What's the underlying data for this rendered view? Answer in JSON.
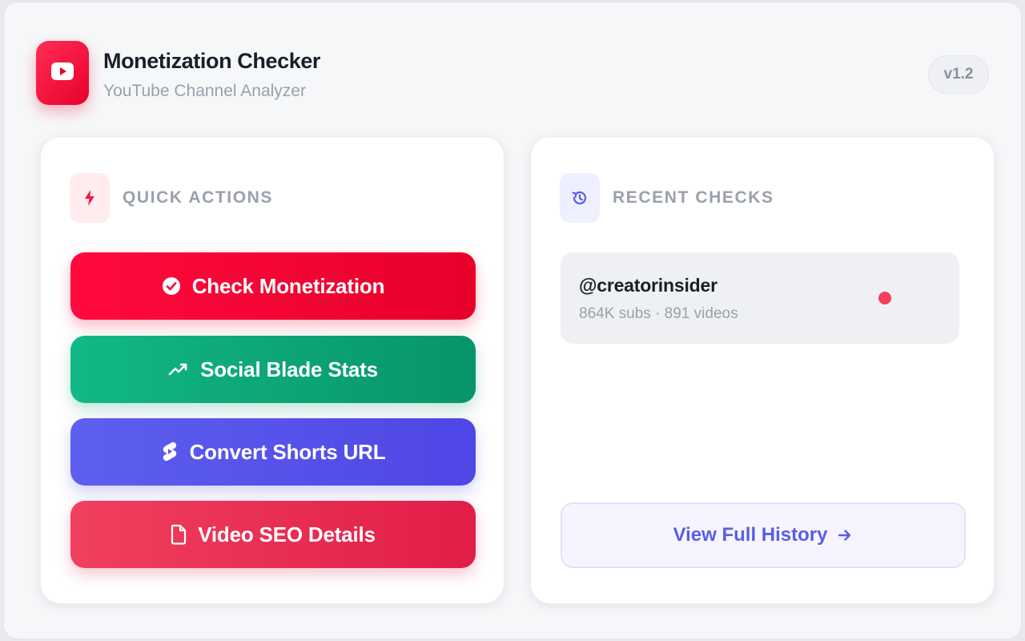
{
  "app": {
    "title": "Monetization Checker",
    "subtitle": "YouTube Channel Analyzer",
    "version": "v1.2",
    "logo_icon": "youtube-play-icon",
    "brand_color": "#e8002a"
  },
  "quick_actions": {
    "heading": "QUICK ACTIONS",
    "heading_icon": "lightning-bolt-icon",
    "buttons": [
      {
        "label": "Check Monetization",
        "icon": "check-circle-icon",
        "color": "#ff0a3f"
      },
      {
        "label": "Social Blade Stats",
        "icon": "trending-up-icon",
        "color": "#12b886"
      },
      {
        "label": "Convert Shorts URL",
        "icon": "shorts-icon",
        "color": "#5d5fef"
      },
      {
        "label": "Video SEO Details",
        "icon": "document-icon",
        "color": "#f1405f"
      }
    ]
  },
  "recent_checks": {
    "heading": "RECENT CHECKS",
    "heading_icon": "history-icon",
    "items": [
      {
        "handle": "@creatorinsider",
        "meta": "864K subs · 891 videos",
        "status_color": "#f43f5e"
      }
    ],
    "view_all_label": "View Full History",
    "view_all_icon": "arrow-right-icon"
  }
}
